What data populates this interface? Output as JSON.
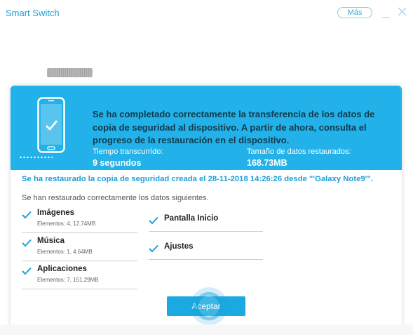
{
  "window": {
    "title": "Smart Switch",
    "more_label": "Más"
  },
  "banner": {
    "message": "Se ha completado correctamente la transferencia de los datos de copia de seguridad al dispositivo. A partir de ahora, consulta el progreso de la restauración en el dispositivo.",
    "elapsed_label": "Tiempo transcurrido:",
    "elapsed_value": "9 segundos",
    "size_label": "Tamaño de datos restaurados:",
    "size_value": "168.73MB",
    "color": "#22b1e8"
  },
  "restore_note": "Se ha restaurado la copia de seguridad creada el 28-11-2018 14:26:26 desde \"'Galaxy Note9'\".",
  "restored_heading": "Se han restaurado correctamente los datos siguientes.",
  "items": [
    {
      "name": "Imágenes",
      "detail": "Elementos: 4, 12.74MB"
    },
    {
      "name": "Música",
      "detail": "Elementos: 1, 4.64MB"
    },
    {
      "name": "Aplicaciones",
      "detail": "Elementos: 7, 151.29MB"
    },
    {
      "name": "Pantalla Inicio",
      "detail": ""
    },
    {
      "name": "Ajustes",
      "detail": ""
    }
  ],
  "accept_label": "Aceptar",
  "accent_color": "#1aa9e1",
  "icons": [
    "phone-check-icon",
    "check-icon",
    "close-icon",
    "minimize-icon"
  ]
}
